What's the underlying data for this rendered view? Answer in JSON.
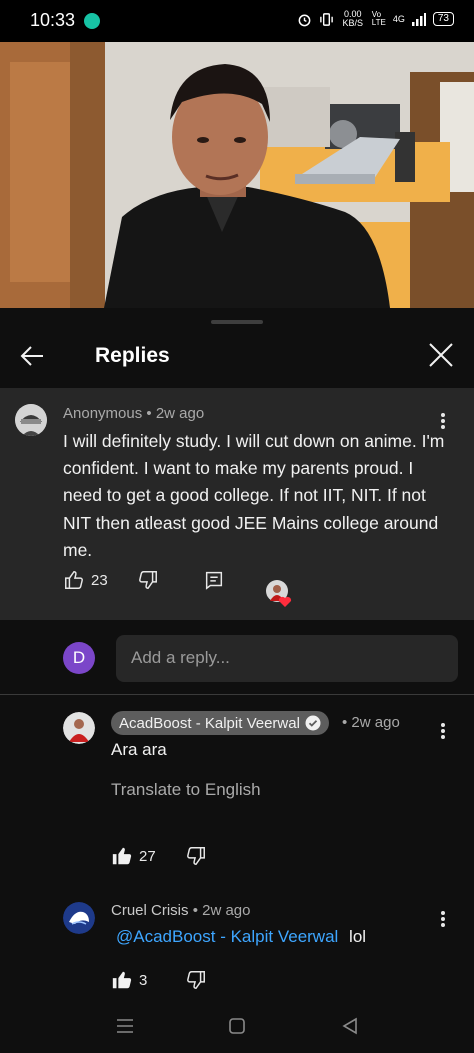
{
  "status_bar": {
    "time": "10:33",
    "net_speed": "0.00 KB/S",
    "network": "4G",
    "battery": "73"
  },
  "sheet": {
    "title": "Replies"
  },
  "parent_comment": {
    "author": "Anonymous",
    "age": "2w ago",
    "text": "I will definitely study. I will cut down on anime. I'm confident. I want to make my parents proud. I need to get a good college. If not IIT, NIT. If not NIT then atleast good JEE Mains college around me.",
    "likes": "23"
  },
  "reply_box": {
    "avatar_letter": "D",
    "placeholder": "Add a reply..."
  },
  "replies": [
    {
      "author": "AcadBoost - Kalpit Veerwal",
      "age": "2w ago",
      "text": "Ara ara",
      "translate": "Translate to English",
      "likes": "27"
    },
    {
      "author": "Cruel Crisis",
      "age": "2w ago",
      "mention": "@AcadBoost - Kalpit Veerwal",
      "text": "lol",
      "likes": "3"
    }
  ],
  "colors": {
    "sheet_bg": "#0f0f0f",
    "card_bg": "#272727",
    "mention": "#3ea6ff",
    "avatar_d": "#7b46c9"
  }
}
